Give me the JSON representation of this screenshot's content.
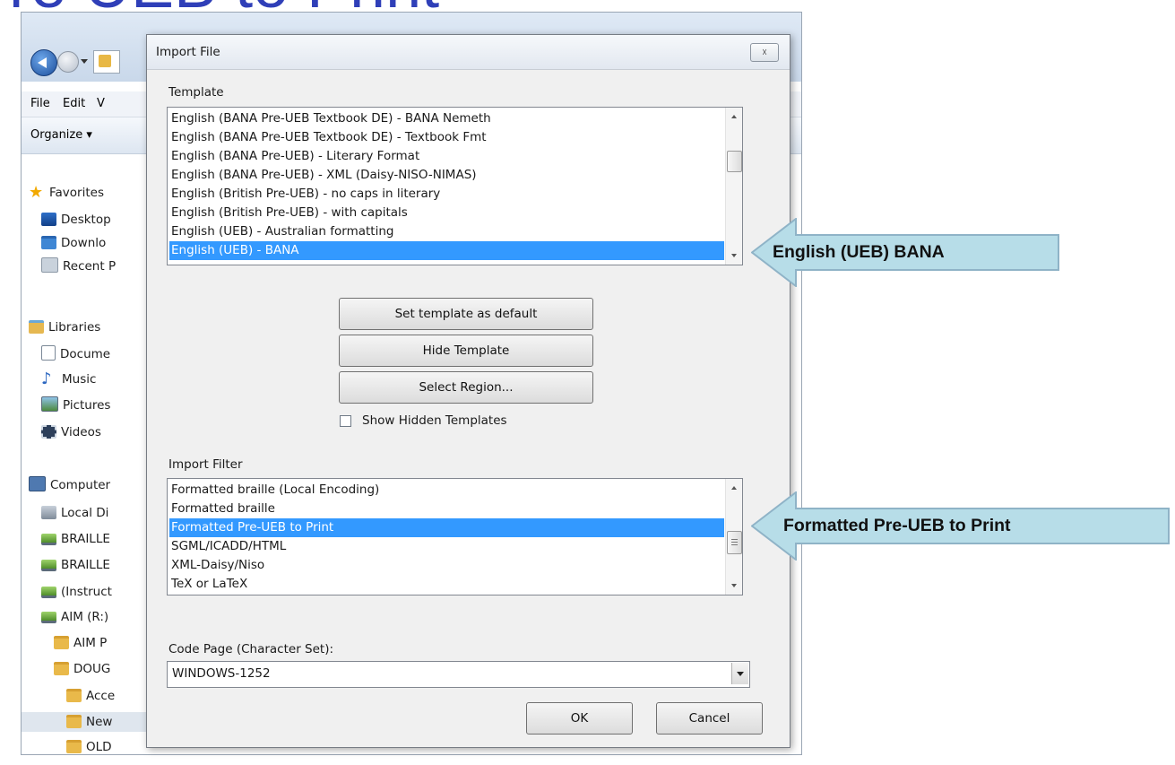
{
  "slide": {
    "title": "re UEB to Print"
  },
  "explorer": {
    "menu": [
      "File",
      "Edit",
      "V"
    ],
    "organize_label": "Organize ▾",
    "tree": [
      {
        "label": "Favorites",
        "icon": "star-icon"
      },
      {
        "label": "Desktop",
        "icon": "desktop-icon"
      },
      {
        "label": "Downlo",
        "icon": "downloads-folder-icon"
      },
      {
        "label": "Recent P",
        "icon": "recent-places-icon"
      },
      {
        "label": "Libraries",
        "icon": "libraries-icon"
      },
      {
        "label": "Docume",
        "icon": "document-icon"
      },
      {
        "label": "Music",
        "icon": "music-icon"
      },
      {
        "label": "Pictures",
        "icon": "pictures-icon"
      },
      {
        "label": "Videos",
        "icon": "videos-icon"
      },
      {
        "label": "Computer",
        "icon": "computer-icon"
      },
      {
        "label": "Local Di",
        "icon": "local-disk-icon"
      },
      {
        "label": "BRAILLE",
        "icon": "network-drive-icon"
      },
      {
        "label": "BRAILLE",
        "icon": "network-drive-icon"
      },
      {
        "label": "(Instruct",
        "icon": "network-drive-icon"
      },
      {
        "label": "AIM (R:)",
        "icon": "network-drive-icon"
      },
      {
        "label": "AIM P",
        "icon": "folder-icon"
      },
      {
        "label": "DOUG",
        "icon": "folder-icon"
      },
      {
        "label": "Acce",
        "icon": "folder-icon"
      },
      {
        "label": "New",
        "icon": "folder-icon"
      },
      {
        "label": "OLD",
        "icon": "folder-icon"
      }
    ]
  },
  "dialog": {
    "title": "Import File",
    "close_label": "☓",
    "template_label": "Template",
    "templates": [
      "English (BANA Pre-UEB Textbook DE) - BANA Nemeth",
      "English (BANA Pre-UEB Textbook DE) - Textbook Fmt",
      "English (BANA Pre-UEB) - Literary Format",
      "English (BANA Pre-UEB) - XML (Daisy-NISO-NIMAS)",
      "English (British Pre-UEB) - no caps in literary",
      "English (British Pre-UEB) - with capitals",
      "English (UEB) - Australian formatting",
      "English (UEB) - BANA"
    ],
    "templates_selected": "English (UEB) - BANA",
    "templates_scroll_position": 0.25,
    "buttons": {
      "set_default": "Set template as default",
      "hide_template": "Hide Template",
      "select_region": "Select Region..."
    },
    "show_hidden_label": "Show Hidden Templates",
    "show_hidden_checked": false,
    "import_filter_label": "Import Filter",
    "filters": [
      "Formatted braille (Local Encoding)",
      "Formatted braille",
      "Formatted Pre-UEB to Print",
      "SGML/ICADD/HTML",
      "XML-Daisy/Niso",
      "TeX or LaTeX"
    ],
    "filters_selected": "Formatted Pre-UEB to Print",
    "filters_scroll_position": 0.6,
    "code_page_label": "Code Page (Character Set):",
    "code_page_value": "WINDOWS-1252",
    "ok_label": "OK",
    "cancel_label": "Cancel"
  },
  "callouts": {
    "template": "English  (UEB) BANA",
    "filter": "Formatted Pre-UEB to Print",
    "fill_color": "#b7dde8",
    "stroke_color": "#8fb3c7"
  }
}
